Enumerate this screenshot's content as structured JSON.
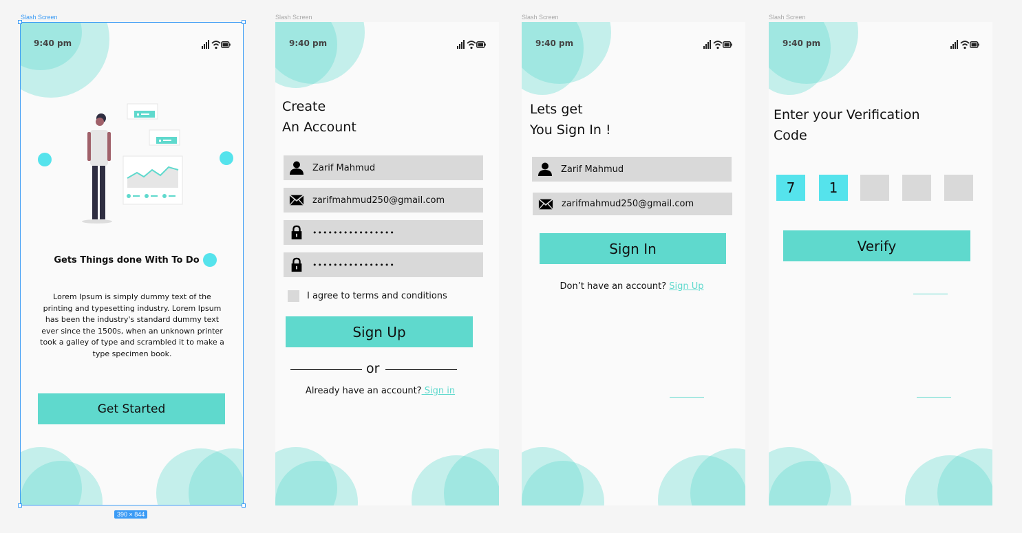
{
  "frames": {
    "label": "Slash Screen",
    "selection_size": "390 × 844"
  },
  "status_bar": {
    "time": "9:40 pm"
  },
  "onboarding": {
    "title": "Gets Things done  With To Do",
    "body": "Lorem Ipsum is simply dummy text of the printing and typesetting industry. Lorem Ipsum has been the industry's standard dummy text ever since the 1500s, when an unknown printer took a galley of type and scrambled it to make a type specimen book.",
    "button": "Get Started"
  },
  "signup": {
    "heading_line1": "Create",
    "heading_line2": "An Account",
    "name_value": "Zarif Mahmud",
    "email_value": "zarifmahmud250@gmail.com",
    "password_value": "••••••••••••••••",
    "confirm_value": "••••••••••••••••",
    "terms_label": "I agree to terms and conditions",
    "button": "Sign Up",
    "divider_text": "or",
    "footer_text": "Already have an account?",
    "footer_link": " Sign in"
  },
  "signin": {
    "heading_line1": "Lets get",
    "heading_line2": "You Sign In !",
    "name_value": "Zarif Mahmud",
    "email_value": "zarifmahmud250@gmail.com",
    "button": "Sign In",
    "footer_text": "Don’t  have an account?",
    "footer_link": "Sign Up"
  },
  "verify": {
    "heading_line1": "Enter your Verification",
    "heading_line2": "Code",
    "codes": [
      "7",
      "1",
      "",
      "",
      ""
    ],
    "button": "Verify"
  },
  "colors": {
    "accent": "#5fd9cd",
    "code_active": "#55e3ec",
    "field": "#d9d9d9",
    "selection": "#3b9bf5"
  }
}
